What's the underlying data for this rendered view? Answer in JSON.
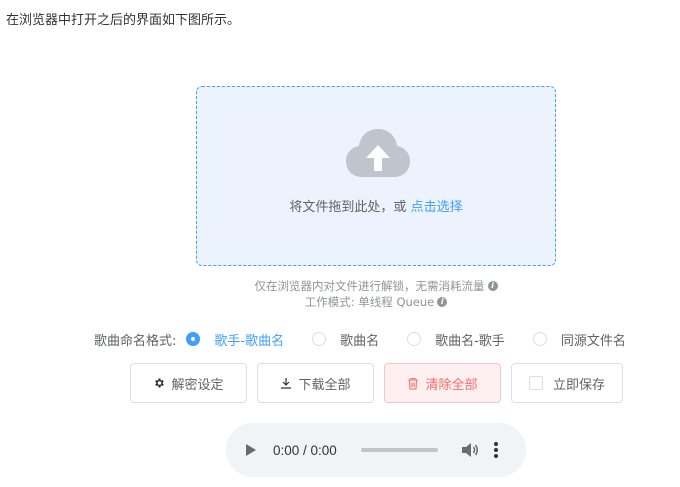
{
  "intro_text": "在浏览器中打开之后的界面如下图所示。",
  "upload": {
    "prompt": "将文件拖到此处，或",
    "link": "点击选择",
    "hint1": "仅在浏览器内对文件进行解锁，无需消耗流量",
    "hint2": "工作模式: 单线程 Queue",
    "info_symbol": "i"
  },
  "naming": {
    "label": "歌曲命名格式:",
    "options": [
      {
        "label": "歌手-歌曲名",
        "checked": true
      },
      {
        "label": "歌曲名",
        "checked": false
      },
      {
        "label": "歌曲名-歌手",
        "checked": false
      },
      {
        "label": "同源文件名",
        "checked": false
      }
    ]
  },
  "buttons": {
    "settings": "解密设定",
    "download_all": "下载全部",
    "clear_all": "清除全部",
    "save_now": "立即保存"
  },
  "player": {
    "time": "0:00 / 0:00"
  },
  "colors": {
    "accent": "#409eff",
    "danger": "#f56c6c",
    "dropzone_bg": "#ecf3fd"
  },
  "icons": {
    "upload": "cloud-upload-icon",
    "settings": "gear-icon",
    "download": "download-icon",
    "clear": "trash-icon",
    "play": "play-icon",
    "volume": "volume-icon",
    "more": "more-vertical-icon"
  }
}
